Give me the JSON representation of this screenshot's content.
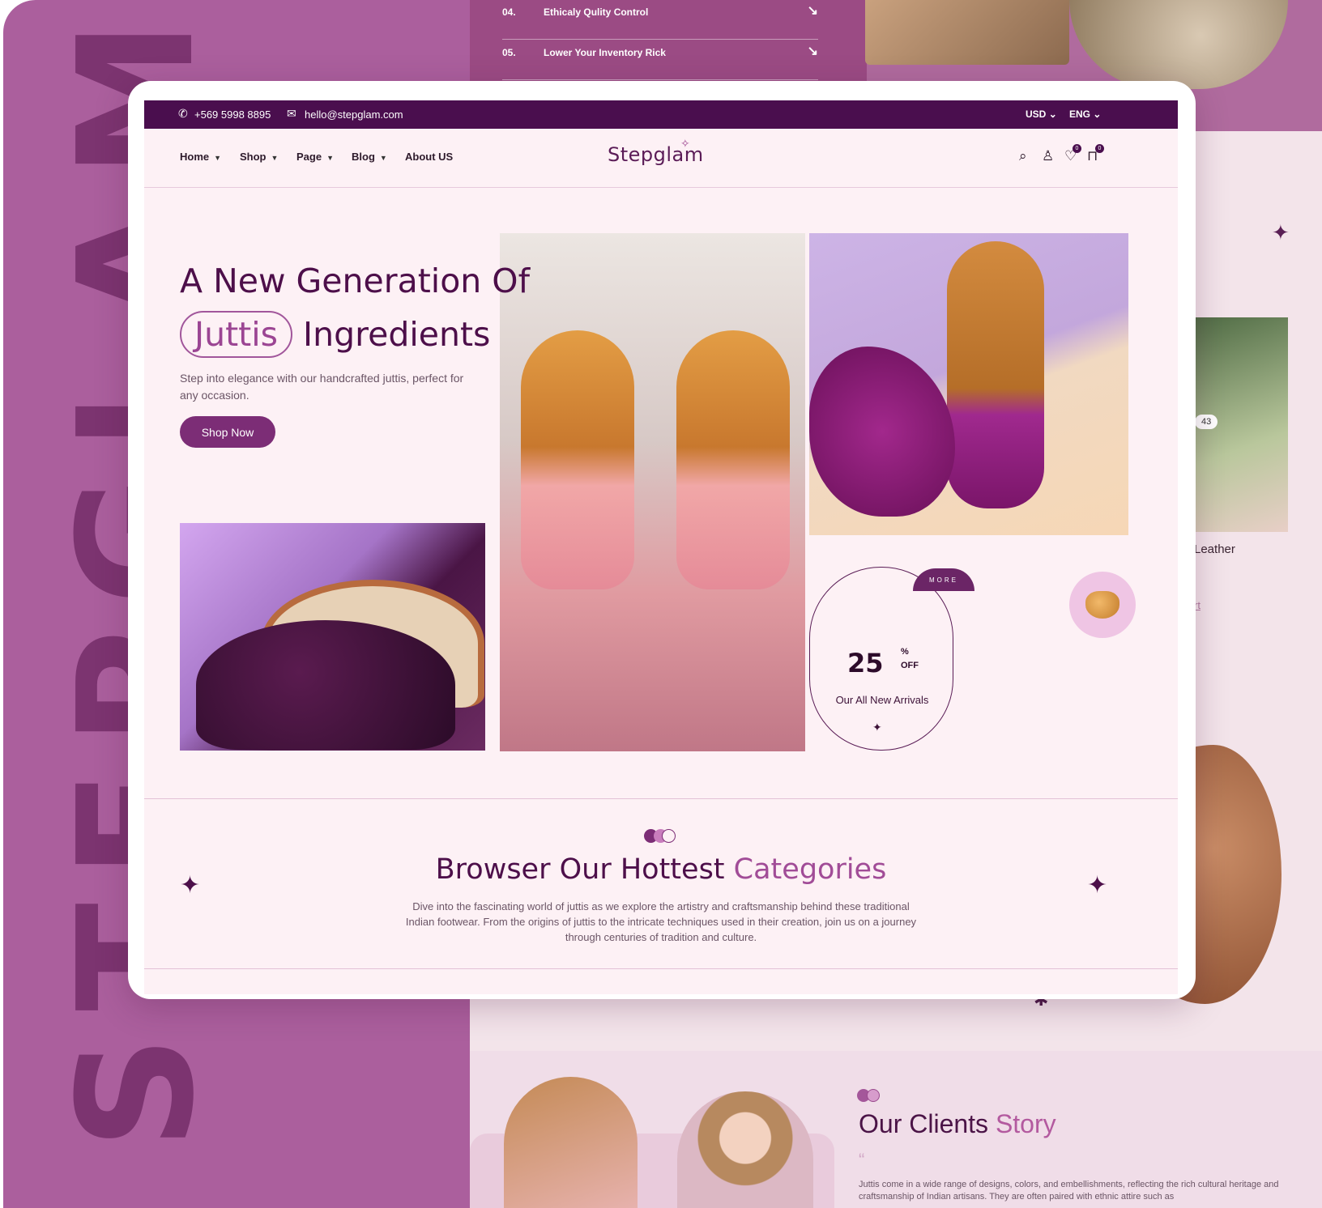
{
  "background": {
    "vertical_brand": "STEPGLAM",
    "feature_rows": [
      {
        "num": "04.",
        "text": "Ethicaly Qulity Control",
        "arrow": "↘"
      },
      {
        "num": "05.",
        "text": "Lower Your Inventory Rick",
        "arrow": "↘"
      }
    ],
    "product_badge": "43",
    "product_name": "Leather",
    "product_link": "rt",
    "clients": {
      "title_main": "Our Clients",
      "title_accent": "Story",
      "quote_mark": "“",
      "text": "Juttis come in a wide range of designs, colors, and embellishments, reflecting the rich cultural heritage and craftsmanship of Indian artisans. They are often paired with ethnic attire such as"
    }
  },
  "topbar": {
    "phone": "+569 5998 8895",
    "email": "hello@stepglam.com",
    "currency": "USD",
    "language": "ENG"
  },
  "nav": {
    "items": [
      "Home",
      "Shop",
      "Page",
      "Blog",
      "About US"
    ],
    "logo": "Stepglam",
    "wishlist_count": "0",
    "cart_count": "0"
  },
  "hero": {
    "title_line1": "A New Generation Of",
    "title_pill": "Juttis",
    "title_line2_rest": "Ingredients",
    "description": "Step into elegance with our handcrafted juttis, perfect for any occasion.",
    "cta": "Shop Now"
  },
  "offer": {
    "ribbon": "MORE",
    "number": "25",
    "percent": "%",
    "off": "OFF",
    "label": "Our All New Arrivals"
  },
  "categories": {
    "title_main": "Browser Our Hottest",
    "title_accent": "Categories",
    "description": "Dive into the fascinating world of juttis as we explore the artistry and craftsmanship behind these traditional Indian footwear. From the origins of juttis to the intricate techniques used in their creation, join us on a journey through centuries of tradition and culture."
  },
  "colors": {
    "brand_dark": "#4a0e4e",
    "brand_accent": "#a14c97",
    "page_bg": "#fdf1f5",
    "outer_purple": "#ab5f9d"
  }
}
